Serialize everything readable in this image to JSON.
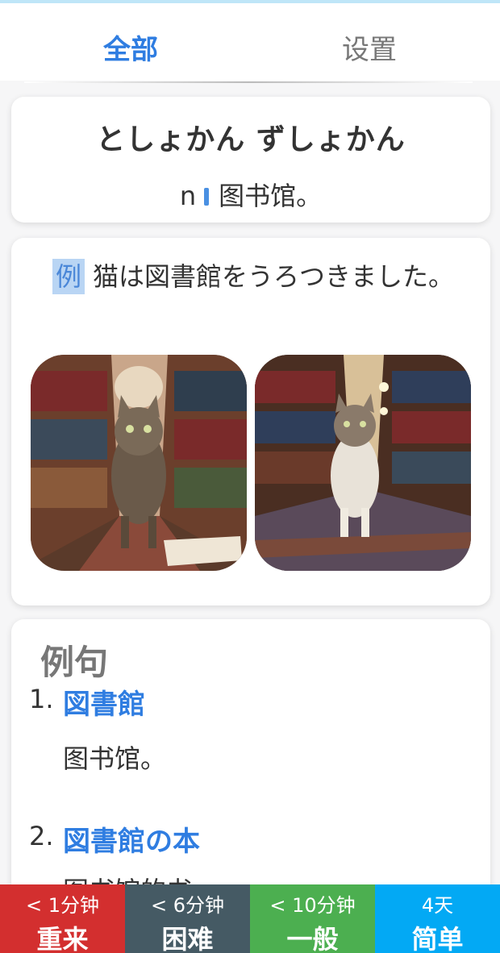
{
  "tabs": {
    "all": "全部",
    "settings": "设置"
  },
  "word": {
    "reading": "としょかん ずしょかん",
    "pos": "n",
    "meaning": "图书馆。"
  },
  "example": {
    "tag": "例",
    "sentence": "猫は図書館をうろつきました。"
  },
  "sentences": {
    "title": "例句",
    "items": [
      {
        "num": "1.",
        "jp": "図書館",
        "cn": "图书馆。"
      },
      {
        "num": "2.",
        "jp": "図書館の本",
        "cn": "图书馆的书"
      }
    ]
  },
  "buttons": [
    {
      "time": "< 1分钟",
      "label": "重来",
      "color": "#d32f2f"
    },
    {
      "time": "< 6分钟",
      "label": "困难",
      "color": "#455a64"
    },
    {
      "time": "< 10分钟",
      "label": "一般",
      "color": "#4caf50"
    },
    {
      "time": "4天",
      "label": "简单",
      "color": "#03a9f4"
    }
  ]
}
